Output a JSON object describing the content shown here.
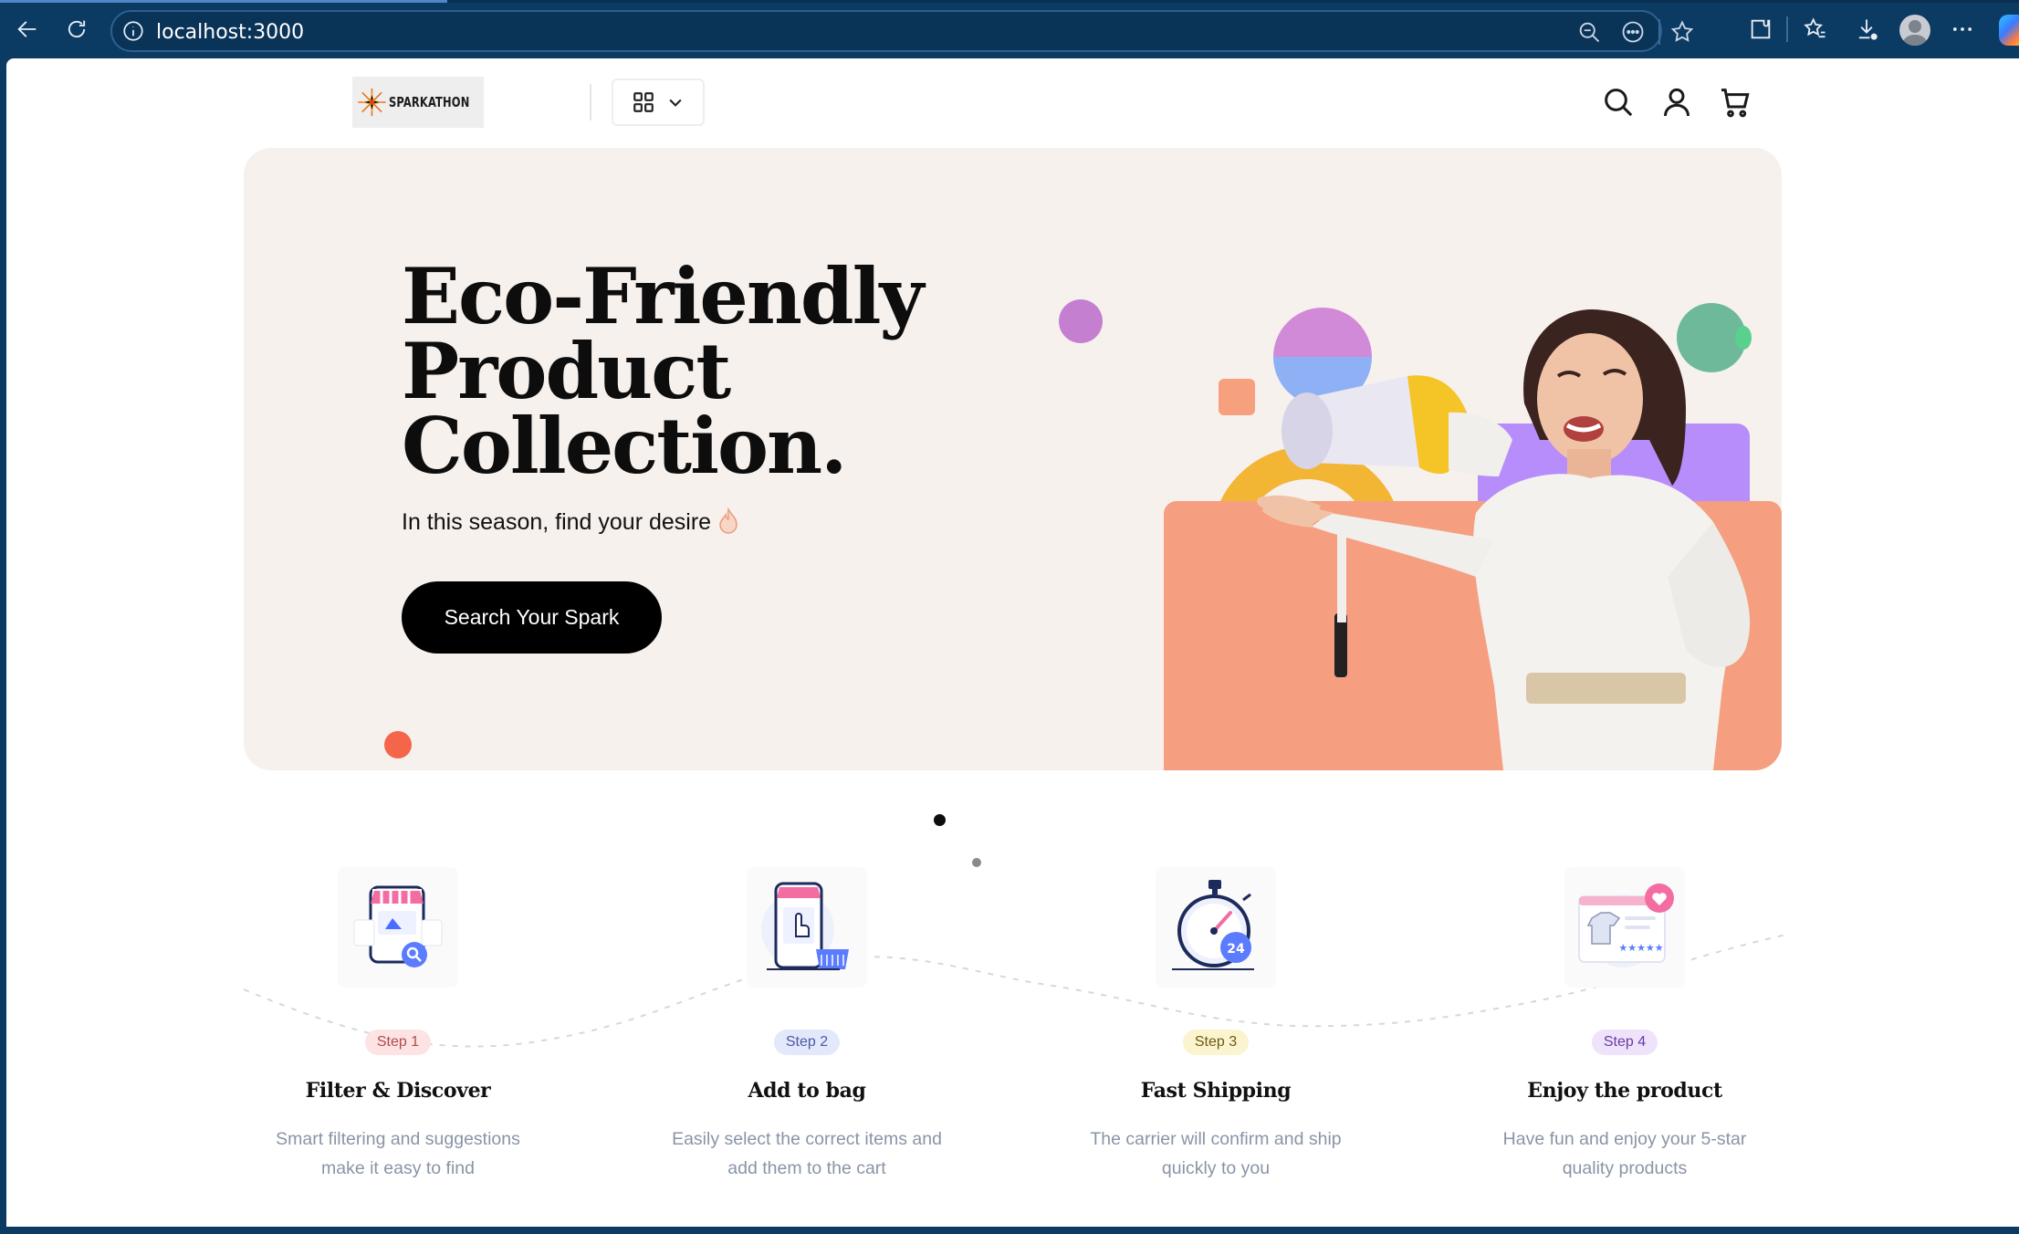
{
  "browser": {
    "url": "localhost:3000"
  },
  "header": {
    "logo_text": "SPARKATHON"
  },
  "hero": {
    "title_lines": [
      "Eco-Friendly",
      "Product",
      "Collection."
    ],
    "subtitle": "In this season, find your desire",
    "cta_label": "Search Your Spark"
  },
  "steps": [
    {
      "badge": "Step 1",
      "title": "Filter & Discover",
      "desc": "Smart filtering and suggestions make it easy to find",
      "badge_bg": "#fde3e3",
      "badge_color": "#b24a4a"
    },
    {
      "badge": "Step 2",
      "title": "Add to bag",
      "desc": "Easily select the correct items and add them to the cart",
      "badge_bg": "#e4e8fb",
      "badge_color": "#4a57a8"
    },
    {
      "badge": "Step 3",
      "title": "Fast Shipping",
      "desc": "The carrier will confirm and ship quickly to you",
      "badge_bg": "#fbf4cf",
      "badge_color": "#6b5a14"
    },
    {
      "badge": "Step 4",
      "title": "Enjoy the product",
      "desc": "Have fun and enjoy your 5-star quality products",
      "badge_bg": "#efe3fb",
      "badge_color": "#6b3aa3"
    }
  ],
  "colors": {
    "hero_bg": "#f7f1ed",
    "cta_bg": "#000000",
    "browser_chrome": "#0b3a63"
  }
}
